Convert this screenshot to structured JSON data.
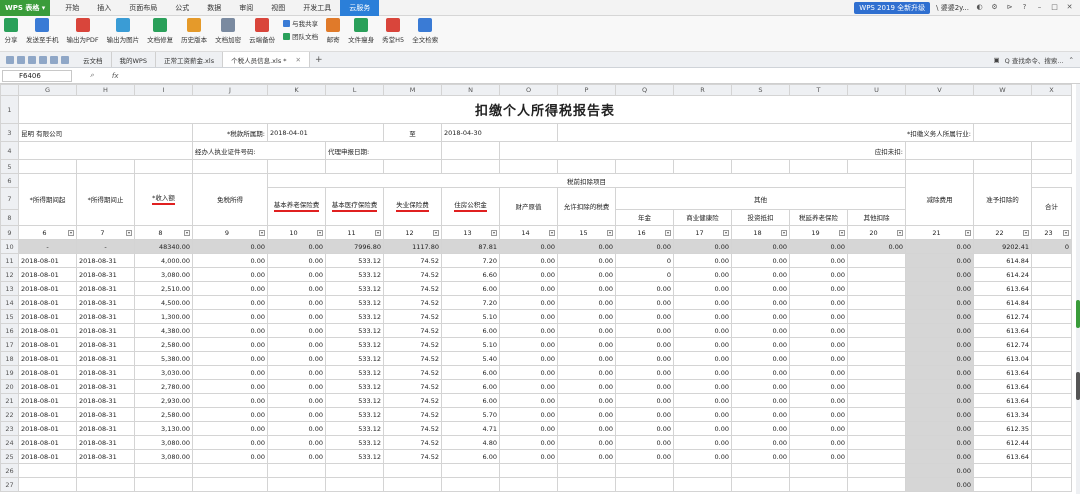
{
  "menubar": {
    "app": "WPS 表格",
    "items": [
      "开始",
      "插入",
      "页面布局",
      "公式",
      "数据",
      "审阅",
      "视图",
      "开发工具",
      "云服务"
    ],
    "active_index": 8,
    "upgrade": "WPS 2019 全新升级",
    "user": "\\ 婆婆2y..."
  },
  "toolbar": {
    "buttons": [
      {
        "label": "分享",
        "icon": "share-icon",
        "color": "#2aa05a"
      },
      {
        "label": "发送至手机",
        "icon": "phone-icon",
        "color": "#3a7bd5"
      },
      {
        "label": "输出为PDF",
        "icon": "pdf-icon",
        "color": "#d9453b"
      },
      {
        "label": "输出为图片",
        "icon": "image-icon",
        "color": "#3a9cd5"
      },
      {
        "label": "文档修复",
        "icon": "repair-icon",
        "color": "#2aa05a"
      },
      {
        "label": "历史版本",
        "icon": "history-icon",
        "color": "#e59a2a"
      },
      {
        "label": "文档加密",
        "icon": "lock-icon",
        "color": "#7a8aa0"
      },
      {
        "label": "云端备份",
        "icon": "cloud-backup-icon",
        "color": "#d9453b"
      }
    ],
    "pair": [
      "与我共享",
      "团队文档"
    ],
    "buttons2": [
      {
        "label": "邮寄",
        "icon": "mail-icon",
        "color": "#e07a2a"
      },
      {
        "label": "文件瘦身",
        "icon": "slim-icon",
        "color": "#2aa05a"
      },
      {
        "label": "秀堂H5",
        "icon": "h5-icon",
        "color": "#d9453b"
      },
      {
        "label": "全文检索",
        "icon": "search-doc-icon",
        "color": "#3a7bd5"
      }
    ]
  },
  "tabs": {
    "items": [
      "云文档",
      "我的WPS",
      "正常工资薪金.xls",
      "个税人员信息.xls *"
    ],
    "active_index": 3,
    "search_placeholder": "查找命令、搜索..."
  },
  "formula_bar": {
    "cell": "F6406",
    "fx": "fx",
    "value": ""
  },
  "sheet": {
    "columns": [
      "G",
      "H",
      "I",
      "J",
      "K",
      "L",
      "M",
      "N",
      "O",
      "P",
      "Q",
      "R",
      "S",
      "T",
      "U",
      "V",
      "W",
      "X"
    ],
    "title": "扣缴个人所得税报告表",
    "row3": {
      "company": "昆明                有限公司",
      "period_label": "*税款所属期:",
      "period_from": "2018-04-01",
      "to": "至",
      "period_to": "2018-04-30",
      "industry_label": "*扣缴义务人所属行业:"
    },
    "row4": {
      "agent_cert": "经办人执业证件号码:",
      "agent_date": "代理申报日期:",
      "tax_due": "应扣未扣:"
    },
    "header": {
      "pre_tax": "税前扣除项目",
      "start": "*所得期间起",
      "end": "*所得期间止",
      "income": "*收入额",
      "exempt": "免税所得",
      "pension": "基本养老保险费",
      "medical": "基本医疗保险费",
      "unemploy": "失业保险费",
      "housing": "住房公积金",
      "property": "财产原值",
      "allowed": "允许扣除的税费",
      "other": "其他",
      "annuity": "年金",
      "health": "商业健康险",
      "invest": "投资抵扣",
      "deferred": "税延养老保险",
      "other_deduct": "其他扣除",
      "total": "合计",
      "reduce": "减除费用",
      "allowed_donation": "准予扣除的"
    },
    "numbers": [
      "6",
      "7",
      "8",
      "9",
      "10",
      "11",
      "12",
      "13",
      "14",
      "15",
      "16",
      "17",
      "18",
      "19",
      "20",
      "21",
      "22",
      "23"
    ],
    "summary": [
      "-",
      "-",
      "48340.00",
      "0.00",
      "0.00",
      "7996.80",
      "1117.80",
      "87.81",
      "0.00",
      "0.00",
      "0.00",
      "0.00",
      "0.00",
      "0.00",
      "0.00",
      "0.00",
      "9202.41",
      "0"
    ],
    "rows": [
      {
        "r": "11",
        "start": "2018-08-01",
        "end": "2018-08-31",
        "income": "4,000.00",
        "n": "533.12",
        "m": "74.52",
        "u": "7.20",
        "w": "614.84",
        "o16": "0"
      },
      {
        "r": "12",
        "start": "2018-08-01",
        "end": "2018-08-31",
        "income": "3,080.00",
        "n": "533.12",
        "m": "74.52",
        "u": "6.60",
        "w": "614.24",
        "o16": "0"
      },
      {
        "r": "13",
        "start": "2018-08-01",
        "end": "2018-08-31",
        "income": "2,510.00",
        "n": "533.12",
        "m": "74.52",
        "u": "6.00",
        "w": "613.64",
        "o16": "0.00"
      },
      {
        "r": "14",
        "start": "2018-08-01",
        "end": "2018-08-31",
        "income": "4,500.00",
        "n": "533.12",
        "m": "74.52",
        "u": "7.20",
        "w": "614.84",
        "o16": "0.00"
      },
      {
        "r": "15",
        "start": "2018-08-01",
        "end": "2018-08-31",
        "income": "1,300.00",
        "n": "533.12",
        "m": "74.52",
        "u": "5.10",
        "w": "612.74",
        "o16": "0.00"
      },
      {
        "r": "16",
        "start": "2018-08-01",
        "end": "2018-08-31",
        "income": "4,380.00",
        "n": "533.12",
        "m": "74.52",
        "u": "6.00",
        "w": "613.64",
        "o16": "0.00"
      },
      {
        "r": "17",
        "start": "2018-08-01",
        "end": "2018-08-31",
        "income": "2,580.00",
        "n": "533.12",
        "m": "74.52",
        "u": "5.10",
        "w": "612.74",
        "o16": "0.00"
      },
      {
        "r": "18",
        "start": "2018-08-01",
        "end": "2018-08-31",
        "income": "5,380.00",
        "n": "533.12",
        "m": "74.52",
        "u": "5.40",
        "w": "613.04",
        "o16": "0.00"
      },
      {
        "r": "19",
        "start": "2018-08-01",
        "end": "2018-08-31",
        "income": "3,030.00",
        "n": "533.12",
        "m": "74.52",
        "u": "6.00",
        "w": "613.64",
        "o16": "0.00"
      },
      {
        "r": "20",
        "start": "2018-08-01",
        "end": "2018-08-31",
        "income": "2,780.00",
        "n": "533.12",
        "m": "74.52",
        "u": "6.00",
        "w": "613.64",
        "o16": "0.00"
      },
      {
        "r": "21",
        "start": "2018-08-01",
        "end": "2018-08-31",
        "income": "2,930.00",
        "n": "533.12",
        "m": "74.52",
        "u": "6.00",
        "w": "613.64",
        "o16": "0.00"
      },
      {
        "r": "22",
        "start": "2018-08-01",
        "end": "2018-08-31",
        "income": "2,580.00",
        "n": "533.12",
        "m": "74.52",
        "u": "5.70",
        "w": "613.34",
        "o16": "0.00"
      },
      {
        "r": "23",
        "start": "2018-08-01",
        "end": "2018-08-31",
        "income": "3,130.00",
        "n": "533.12",
        "m": "74.52",
        "u": "4.71",
        "w": "612.35",
        "o16": "0.00"
      },
      {
        "r": "24",
        "start": "2018-08-01",
        "end": "2018-08-31",
        "income": "3,080.00",
        "n": "533.12",
        "m": "74.52",
        "u": "4.80",
        "w": "612.44",
        "o16": "0.00"
      },
      {
        "r": "25",
        "start": "2018-08-01",
        "end": "2018-08-31",
        "income": "3,080.00",
        "n": "533.12",
        "m": "74.52",
        "u": "6.00",
        "w": "613.64",
        "o16": "0.00"
      }
    ],
    "zero": "0.00",
    "row_labels": [
      "1",
      "3",
      "4",
      "5",
      "6",
      "7",
      "8",
      "9",
      "10",
      "26",
      "27"
    ]
  }
}
